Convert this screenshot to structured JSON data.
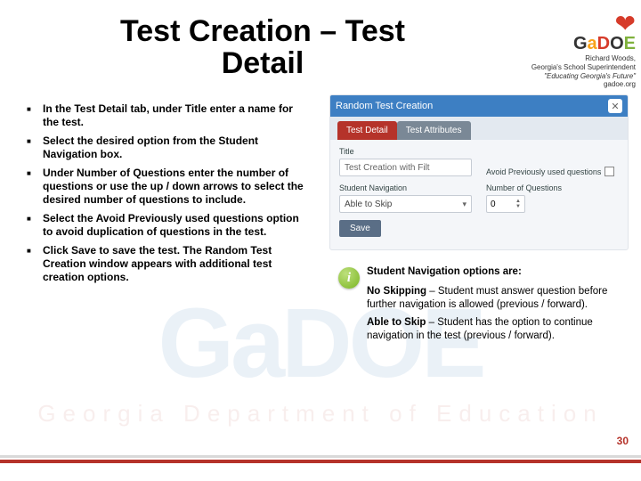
{
  "title": "Test Creation – Test Detail",
  "brand": {
    "name_g": "G",
    "name_a": "a",
    "name_d": "D",
    "name_o": "O",
    "name_e": "E",
    "line1": "Richard Woods,",
    "line2": "Georgia's School Superintendent",
    "line3": "\"Educating Georgia's Future\"",
    "line4": "gadoe.org"
  },
  "bullets": [
    "In the Test Detail tab, under Title enter a name for the test.",
    "Select the desired option from the Student Navigation box.",
    "Under Number of Questions enter the number of questions or use the up / down arrows to select the desired number of questions to include.",
    "Select the Avoid Previously used questions option to avoid duplication of questions in the test.",
    "Click Save to save the test. The Random Test Creation window appears with additional test creation options."
  ],
  "ss": {
    "windowTitle": "Random Test Creation",
    "tab1": "Test Detail",
    "tab2": "Test Attributes",
    "titleLabel": "Title",
    "titleValue": "Test Creation with Filt",
    "avoidLabel": "Avoid Previously used questions",
    "navLabel": "Student Navigation",
    "navValue": "Able to Skip",
    "numqLabel": "Number of Questions",
    "numqValue": "0",
    "save": "Save"
  },
  "info_i": "i",
  "side": {
    "heading_prefix": "Student Navigation",
    "heading_suffix": " options are:",
    "p1b": "No Skipping",
    "p1": " – Student must answer question before further navigation is allowed (previous / forward).",
    "p2b": "Able to Skip",
    "p2": " – Student has the option to continue navigation in the test (previous / forward)."
  },
  "watermark_big": "GaDOE",
  "watermark_small": "Georgia Department of Education",
  "pagenum": "30"
}
